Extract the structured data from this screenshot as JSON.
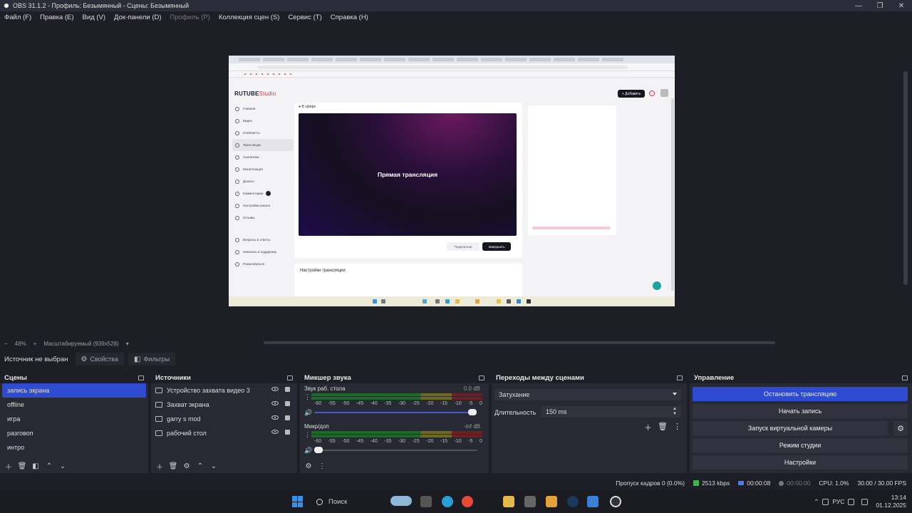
{
  "window": {
    "title": "OBS 31.1.2 - Профиль: Безымянный - Сцены: Безымянный",
    "minimize": "—",
    "maximize": "❐",
    "close": "✕"
  },
  "menu": [
    {
      "label": "Файл (F)",
      "disabled": false
    },
    {
      "label": "Правка (E)",
      "disabled": false
    },
    {
      "label": "Вид (V)",
      "disabled": false
    },
    {
      "label": "Док-панели (D)",
      "disabled": false
    },
    {
      "label": "Профиль (P)",
      "disabled": true
    },
    {
      "label": "Коллекция сцен (S)",
      "disabled": false
    },
    {
      "label": "Сервис (T)",
      "disabled": false
    },
    {
      "label": "Справка (H)",
      "disabled": false
    }
  ],
  "preview": {
    "rutube_logo_main": "RUTUBE",
    "rutube_logo_studio": "Studio",
    "add_button": "+ Добавить",
    "live_label": "● В эфире",
    "player_text": "Прямая трансляция",
    "copy_button": "Поделиться",
    "finish_button": "Завершить",
    "settings_title": "Настройки трансляции",
    "sidebar": [
      "Главная",
      "Видео",
      "Плейлисты",
      "Трансляции",
      "Аналитика",
      "Монетизация",
      "Донаты",
      "Комментарии",
      "Настройки канала",
      "Отзывы",
      "Вопросы и ответы",
      "Написать в поддержку",
      "Пожаловаться"
    ]
  },
  "zoom": {
    "minus": "−",
    "level": "48%",
    "plus": "+",
    "mode": "Масштабируемый (939x528)"
  },
  "source_bar": {
    "no_source": "Источник не выбран",
    "properties": "Свойства",
    "filters": "Фильтры"
  },
  "scenes": {
    "title": "Сцены",
    "items": [
      "запись экрана",
      "offline",
      "игра",
      "разговоп",
      "интро"
    ],
    "selected_index": 0
  },
  "sources": {
    "title": "Источники",
    "items": [
      "Устройство захвата видео 3",
      "Захват экрана",
      "garry s mod",
      "рабочий стол"
    ]
  },
  "mixer": {
    "title": "Микшер звука",
    "scale": [
      "-60",
      "-55",
      "-50",
      "-45",
      "-40",
      "-35",
      "-30",
      "-25",
      "-20",
      "-15",
      "-10",
      "-5",
      "0"
    ],
    "channels": [
      {
        "name": "Звук раб. стола",
        "db": "0.0 dB",
        "volume": 1.0,
        "muted": false
      },
      {
        "name": "Микр/доп",
        "db": "-inf dB",
        "volume": 0.0,
        "muted": false
      }
    ]
  },
  "transitions": {
    "title": "Переходы между сценами",
    "selected": "Затухание",
    "duration_label": "Длительность",
    "duration_value": "150 ms"
  },
  "controls": {
    "title": "Управление",
    "stop_stream": "Остановить трансляцию",
    "start_record": "Начать запись",
    "virtual_cam": "Запуск виртуальной камеры",
    "studio_mode": "Режим студии",
    "settings": "Настройки"
  },
  "status": {
    "dropped_frames": "Пропуск кадров 0 (0.0%)",
    "bitrate": "2513 kbps",
    "stream_time": "00:00:08",
    "record_time": "00:00:00",
    "cpu": "CPU: 1.0%",
    "fps": "30.00 / 30.00 FPS"
  },
  "taskbar": {
    "search_placeholder": "Поиск",
    "lang": "РУС",
    "time": "13:14",
    "date": "01.12.2025"
  },
  "colors": {
    "accent": "#2f4bcf",
    "panel_bg": "#272a33",
    "app_bg": "#1e1f26"
  }
}
